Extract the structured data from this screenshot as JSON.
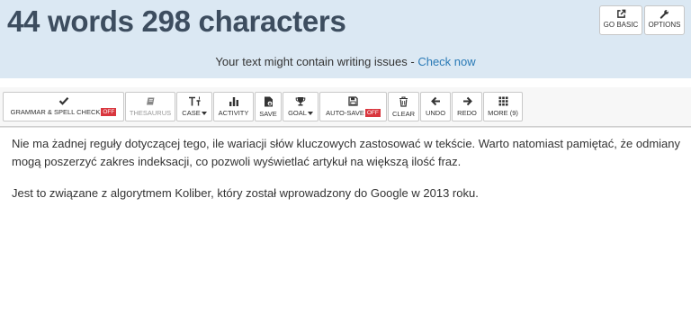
{
  "header": {
    "counter": "44 words 298 characters",
    "go_basic_label": "GO BASIC",
    "options_label": "OPTIONS",
    "issues_text": "Your text might contain writing issues - ",
    "issues_link": "Check now"
  },
  "toolbar": {
    "grammar": {
      "label": "GRAMMAR & SPELL CHECK",
      "badge": "OFF",
      "icon": "check-icon"
    },
    "thesaurus": {
      "label": "THESAURUS",
      "icon": "book-icon"
    },
    "case": {
      "label": "CASE",
      "icon": "text-case-icon"
    },
    "activity": {
      "label": "ACTIVITY",
      "icon": "bar-chart-icon"
    },
    "save": {
      "label": "SAVE",
      "icon": "save-file-icon"
    },
    "goal": {
      "label": "GOAL",
      "icon": "trophy-icon"
    },
    "autosave": {
      "label": "AUTO-SAVE",
      "badge": "OFF",
      "icon": "floppy-icon"
    },
    "clear": {
      "label": "CLEAR",
      "icon": "trash-icon"
    },
    "undo": {
      "label": "UNDO",
      "icon": "arrow-left-icon"
    },
    "redo": {
      "label": "REDO",
      "icon": "arrow-right-icon"
    },
    "more": {
      "label": "MORE (9)",
      "icon": "grid-icon"
    }
  },
  "editor": {
    "paragraph1": "Nie ma żadnej reguły dotyczącej tego, ile wariacji słów kluczowych zastosować w tekście. Warto natomiast pamiętać, że odmiany mogą poszerzyć zakres indeksacji, co pozwoli wyświetlać artykuł na większą ilość fraz.",
    "paragraph2": "Jest to związane z algorytmem Koliber, który został wprowadzony do Google w 2013 roku."
  },
  "colors": {
    "header_bg": "#dbe8f3",
    "counter_text": "#3d4d5f",
    "link": "#2a7ab6",
    "badge_bg": "#d9363e"
  }
}
